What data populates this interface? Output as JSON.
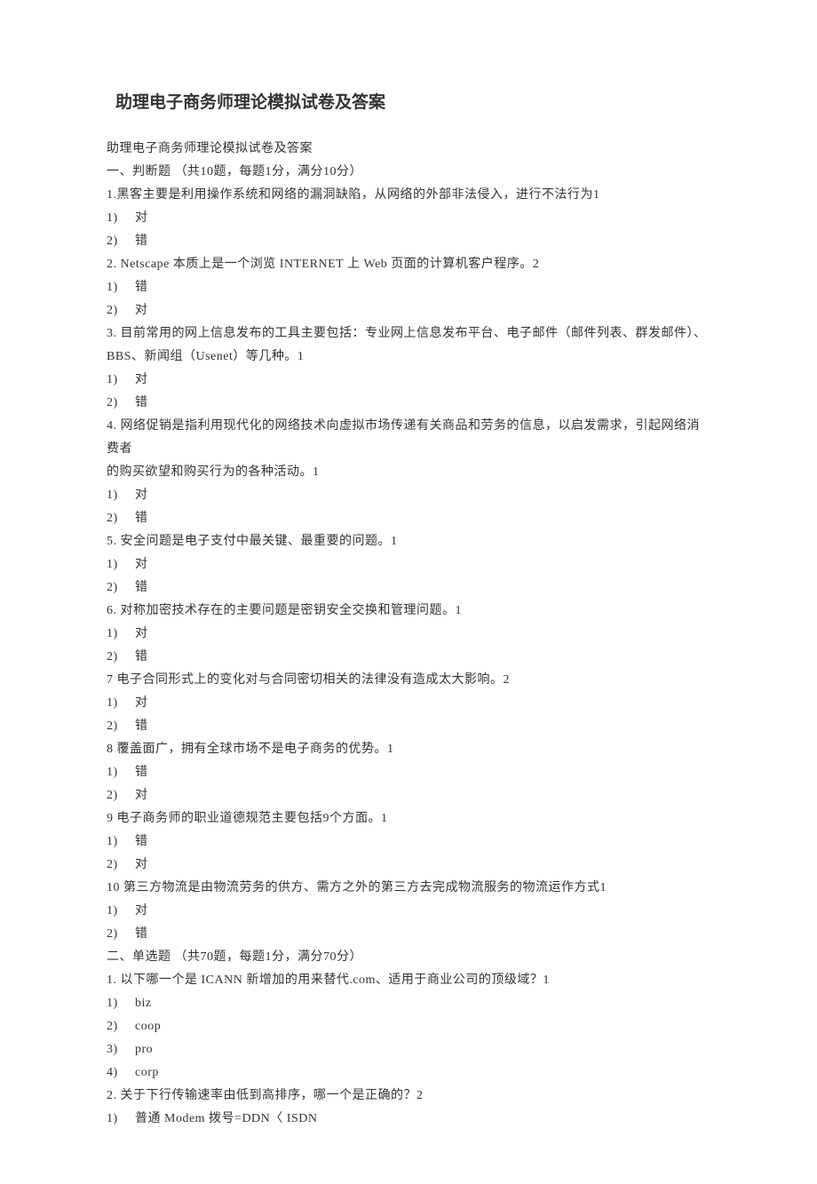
{
  "title": "助理电子商务师理论模拟试卷及答案",
  "subtitle": "助理电子商务师理论模拟试卷及答案",
  "section1_header": "一、判断题 （共10题，每题1分，满分10分）",
  "q1": "1.黑客主要是利用操作系统和网络的漏洞缺陷，从网络的外部非法侵入，进行不法行为1",
  "q1_o1": "对",
  "q1_o2": "错",
  "q2": "2.   Netscape 本质上是一个浏览 INTERNET 上 Web 页面的计算机客户程序。2",
  "q2_o1": "错",
  "q2_o2": "对",
  "q3a": "3.  目前常用的网上信息发布的工具主要包括：专业网上信息发布平台、电子邮件（邮件列表、群发邮件）、",
  "q3b": "BBS、新闻组（Usenet）等几种。1",
  "q3_o1": "对",
  "q3_o2": "错",
  "q4a": "4.  网络促销是指利用现代化的网络技术向虚拟市场传递有关商品和劳务的信息，以启发需求，引起网络消费者",
  "q4b": "的购买欲望和购买行为的各种活动。1",
  "q4_o1": "对",
  "q4_o2": "错",
  "q5": "5.   安全问题是电子支付中最关键、最重要的问题。1",
  "q5_o1": "对",
  "q5_o2": "错",
  "q6": "6.   对称加密技术存在的主要问题是密钥安全交换和管理问题。1",
  "q6_o1": "对",
  "q6_o2": "错",
  "q7": "7    电子合同形式上的变化对与合同密切相关的法律没有造成太大影响。2",
  "q7_o1": "对",
  "q7_o2": "错",
  "q8": "8    覆盖面广，拥有全球市场不是电子商务的优势。1",
  "q8_o1": "错",
  "q8_o2": "对",
  "q9": "9    电子商务师的职业道德规范主要包括9个方面。1",
  "q9_o1": "错",
  "q9_o2": "对",
  "q10": "10  第三方物流是由物流劳务的供方、需方之外的第三方去完成物流服务的物流运作方式1",
  "q10_o1": "对",
  "q10_o2": "错",
  "section2_header": "二、单选题 （共70题，每题1分，满分70分）",
  "s2q1": "1.   以下哪一个是 ICANN 新增加的用来替代.com、适用于商业公司的顶级域？1",
  "s2q1_o1": "biz",
  "s2q1_o2": "coop",
  "s2q1_o3": "pro",
  "s2q1_o4": "corp",
  "s2q2": "2.   关于下行传输速率由低到高排序，哪一个是正确的？2",
  "s2q2_o1": "普通 Modem 拨号=DDN〈 ISDN",
  "opt1": "1)",
  "opt2": "2)",
  "opt3": "3)",
  "opt4": "4)"
}
